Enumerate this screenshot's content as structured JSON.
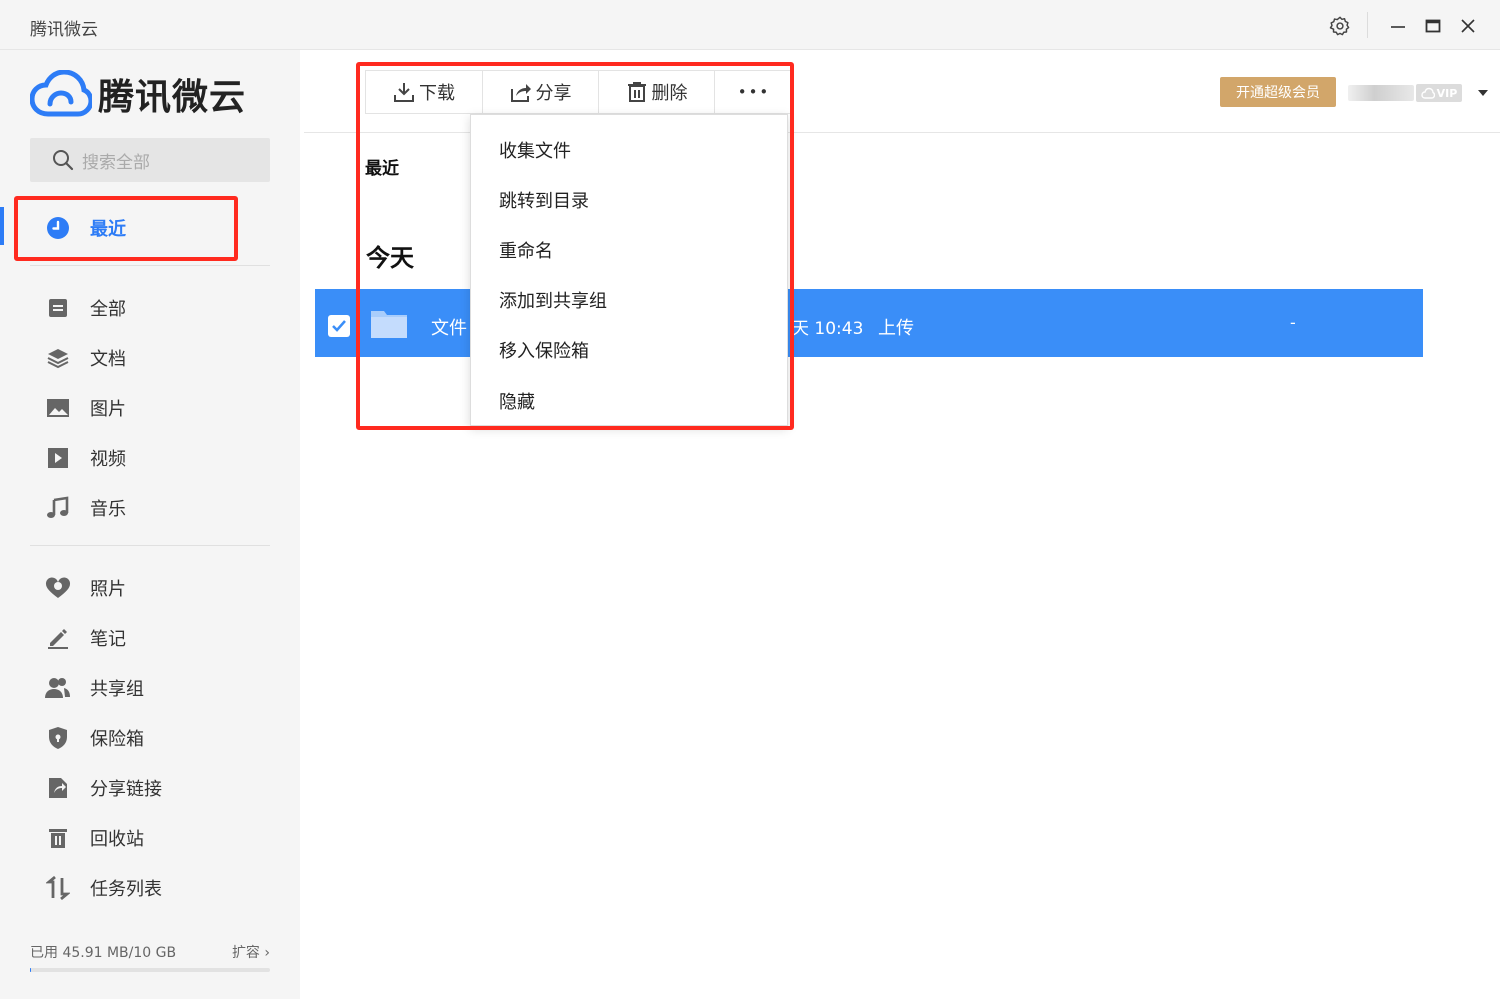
{
  "window": {
    "title": "腾讯微云"
  },
  "logo": {
    "text": "腾讯微云",
    "brand_color": "#2d7cf6"
  },
  "search": {
    "placeholder": "搜索全部"
  },
  "sidebar": {
    "active_item": "最近",
    "items": [
      {
        "label": "最近",
        "icon": "clock-icon"
      },
      {
        "label": "全部",
        "icon": "all-files-icon"
      },
      {
        "label": "文档",
        "icon": "document-stack-icon"
      },
      {
        "label": "图片",
        "icon": "image-icon"
      },
      {
        "label": "视频",
        "icon": "video-icon"
      },
      {
        "label": "音乐",
        "icon": "music-icon"
      },
      {
        "label": "照片",
        "icon": "photo-icon"
      },
      {
        "label": "笔记",
        "icon": "pen-icon"
      },
      {
        "label": "共享组",
        "icon": "group-icon"
      },
      {
        "label": "保险箱",
        "icon": "shield-icon"
      },
      {
        "label": "分享链接",
        "icon": "share-link-icon"
      },
      {
        "label": "回收站",
        "icon": "trash-icon"
      },
      {
        "label": "任务列表",
        "icon": "transfer-icon"
      }
    ],
    "storage": {
      "used_text": "已用 45.91 MB/10 GB",
      "expand_label": "扩容",
      "used_fraction": 0.0045
    }
  },
  "toolbar": {
    "download_label": "下载",
    "share_label": "分享",
    "delete_label": "删除",
    "more_label": "•••"
  },
  "header": {
    "vip_button_label": "开通超级会员",
    "vip_badge": "VIP"
  },
  "content": {
    "section_label": "最近",
    "group_label": "今天",
    "selected_row": {
      "name": "文件",
      "time": "天 10:43",
      "source": "上传",
      "size": "-"
    }
  },
  "more_menu": {
    "items": [
      "收集文件",
      "跳转到目录",
      "重命名",
      "添加到共享组",
      "移入保险箱",
      "隐藏"
    ]
  },
  "colors": {
    "accent": "#2d7cf6",
    "selection": "#3a8ef8",
    "vip_gold": "#d2a66a",
    "highlight_red": "#ff2a1f"
  }
}
